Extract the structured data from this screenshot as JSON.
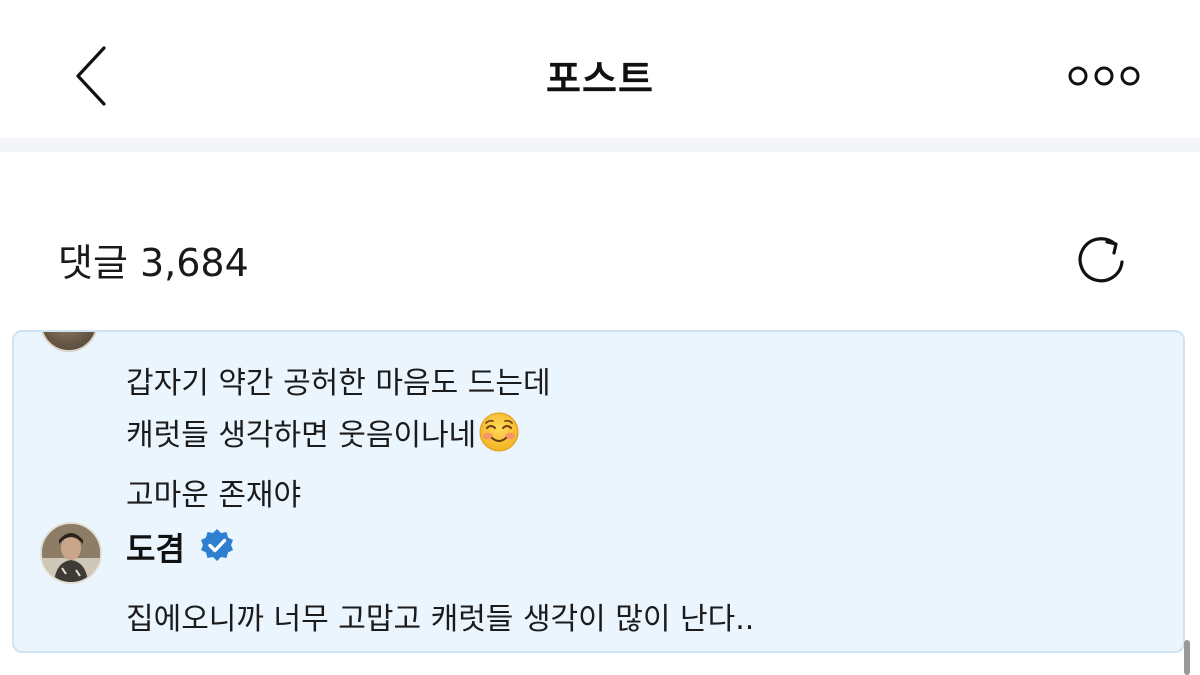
{
  "header": {
    "title": "포스트",
    "back_icon": "chevron-left-icon",
    "more_icon": "ellipsis-circles-icon"
  },
  "comments": {
    "label": "댓글 3,684",
    "refresh_icon": "refresh-icon"
  },
  "thread": {
    "previous_comment": {
      "lines": [
        "갑자기 약간 공허한 마음도 드는데",
        "캐럿들 생각하면 웃음이나네",
        "고마운 존재야"
      ],
      "emoji": "smiling-face-icon"
    },
    "reply": {
      "author": "도겸",
      "verified_icon": "verified-badge-icon",
      "text": "집에오니까 너무 고맙고 캐럿들 생각이 많이 난다.."
    }
  },
  "colors": {
    "card_background": "#eaf5fd",
    "card_border": "#cfe3f3",
    "verified_blue": "#2f7fd1",
    "divider": "#f4f5f8"
  }
}
